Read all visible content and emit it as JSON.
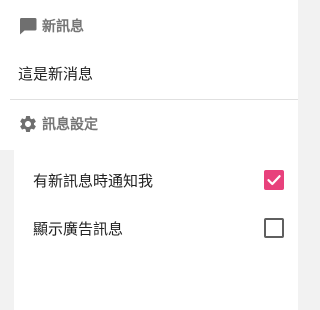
{
  "sections": [
    {
      "title": "新訊息",
      "icon": "chat-bubble-icon",
      "message": "這是新消息"
    },
    {
      "title": "訊息設定",
      "icon": "gear-icon",
      "preferences": [
        {
          "label": "有新訊息時通知我",
          "checked": true
        },
        {
          "label": "顯示廣告訊息",
          "checked": false
        }
      ]
    }
  ],
  "colors": {
    "accent": "#e8417c",
    "header_text": "#757575",
    "body_text": "#212121",
    "background": "#f2f2f2"
  }
}
